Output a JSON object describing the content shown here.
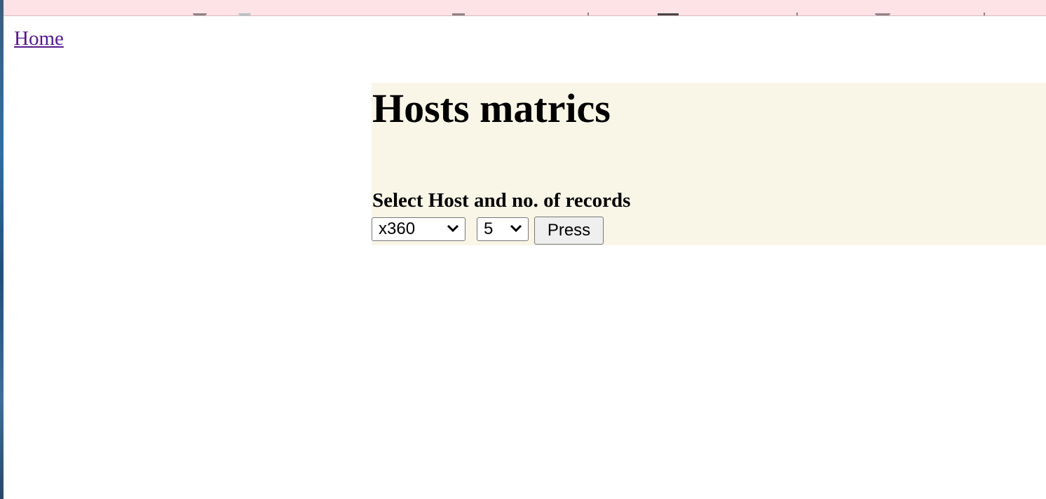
{
  "nav": {
    "home_label": "Home"
  },
  "main": {
    "title": "Hosts matrics",
    "select_label": "Select Host and no. of records",
    "host_select": {
      "selected": "x360",
      "icon": "chevron-down-icon"
    },
    "records_select": {
      "selected": "5",
      "icon": "chevron-down-icon"
    },
    "submit_label": "Press"
  },
  "colors": {
    "panel_background": "#f9f6e8",
    "top_strip": "#fde3e6",
    "visited_link": "#551a8b"
  }
}
